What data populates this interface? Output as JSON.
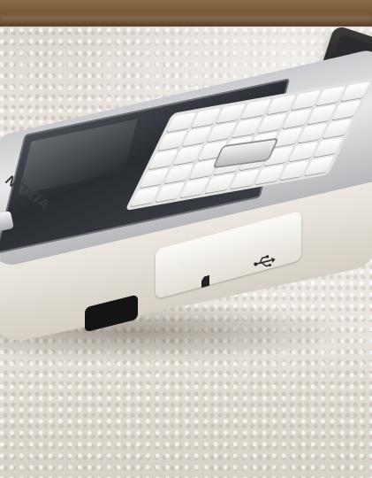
{
  "scene": {
    "description_tags": [
      "phone",
      "blanket",
      "wood-shelf"
    ],
    "phone": {
      "brand": "NOKIA",
      "colors": {
        "body": "#f0ede8",
        "screen": "#2f3237",
        "chrome": "#9ea1a5"
      }
    },
    "icons": {
      "sd": "memory-card-icon",
      "usb": "usb-icon"
    }
  }
}
